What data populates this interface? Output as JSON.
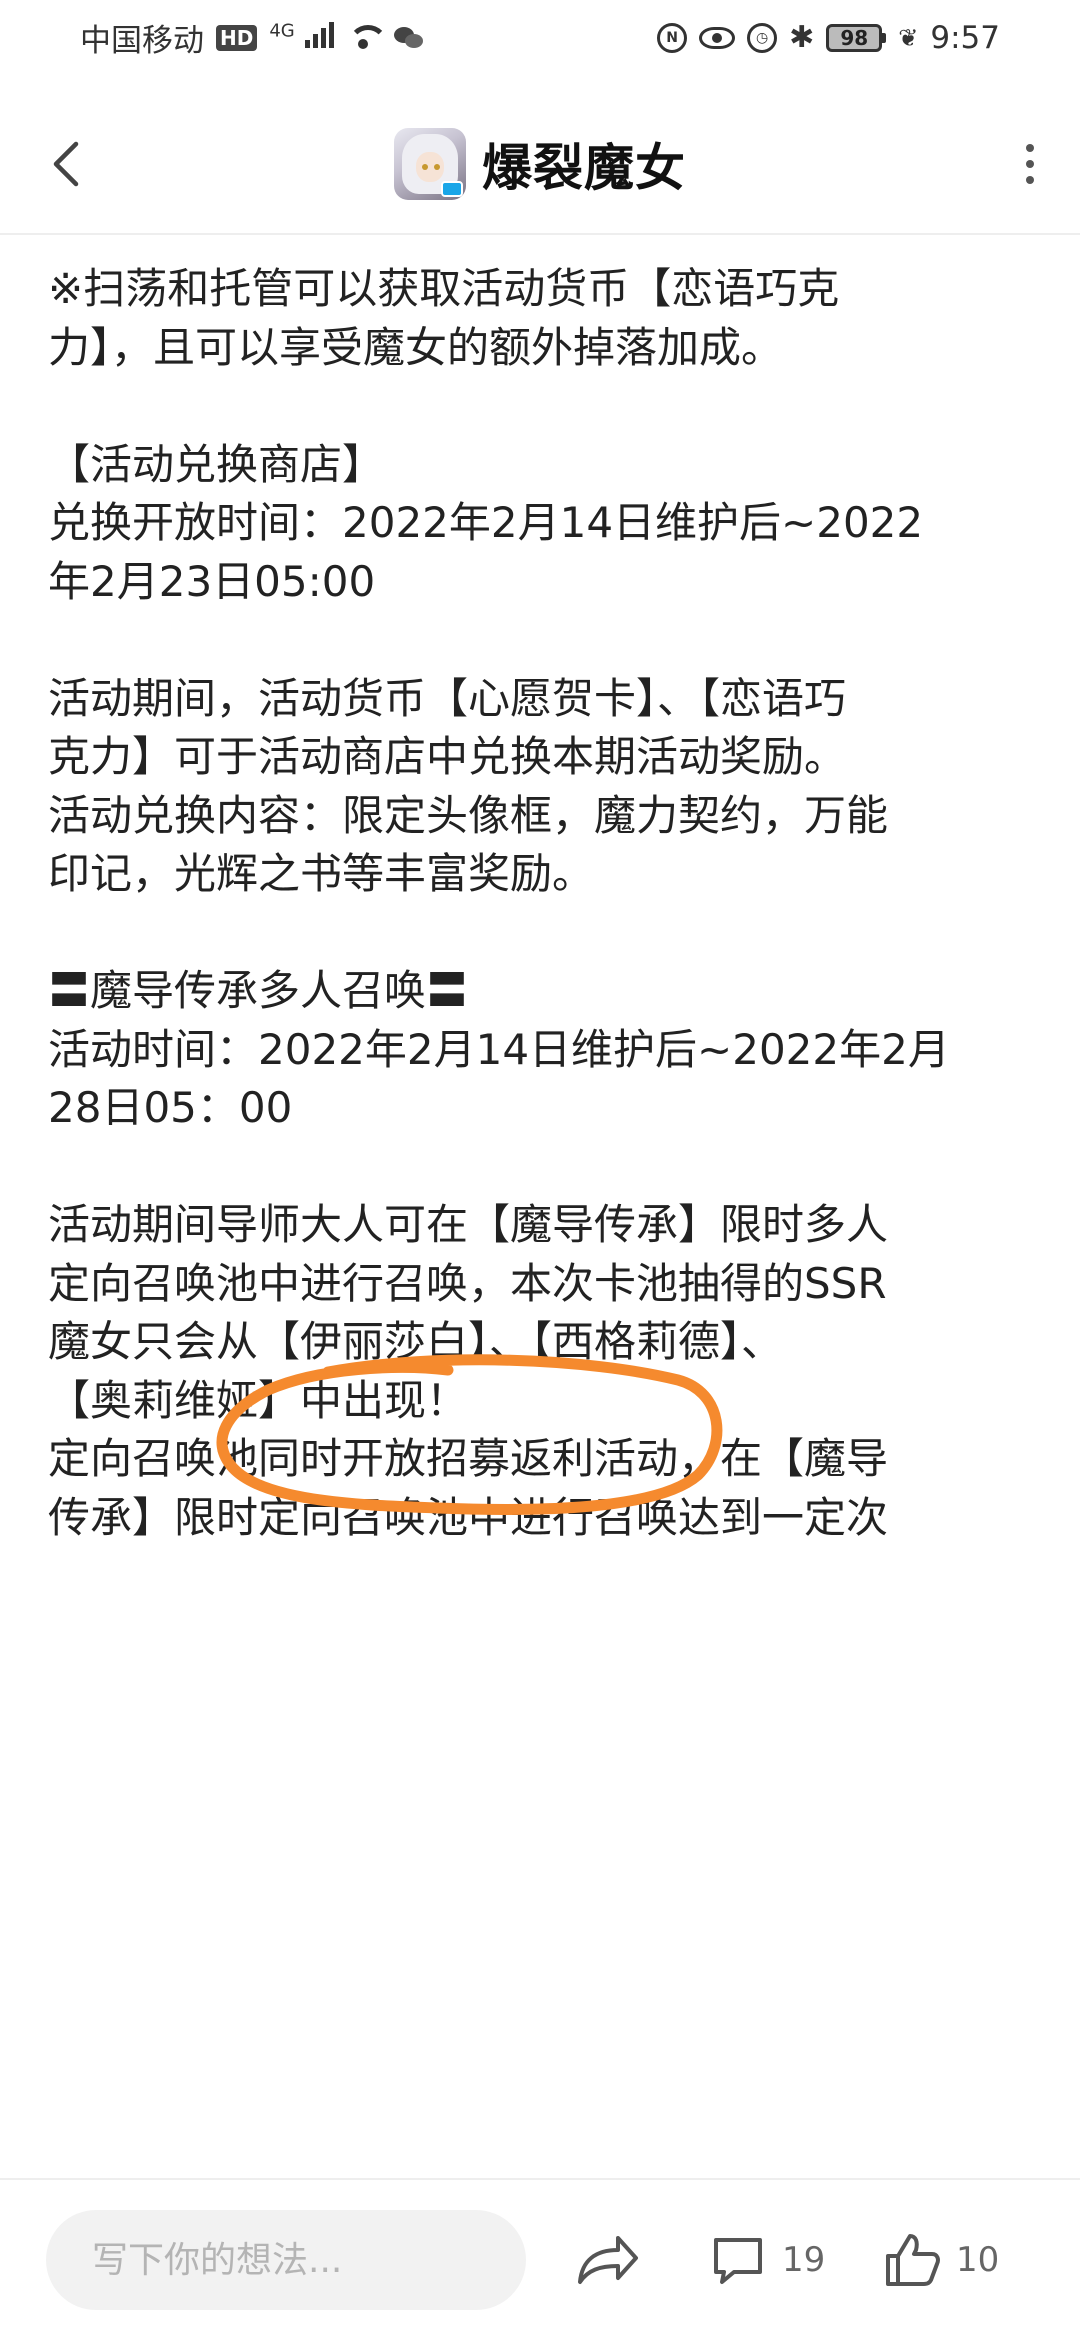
{
  "status_bar": {
    "carrier": "中国移动",
    "hd": "HD",
    "network": "4G",
    "battery": "98",
    "time": "9:57"
  },
  "header": {
    "title": "爆裂魔女"
  },
  "article": {
    "lines": [
      "※扫荡和托管可以获取活动货币【恋语巧克",
      "力】，且可以享受魔女的额外掉落加成。",
      "",
      "【活动兑换商店】",
      "兑换开放时间：2022年2月14日维护后~2022",
      "年2月23日05:00",
      "",
      "活动期间，活动货币【心愿贺卡】、【恋语巧",
      "克力】可于活动商店中兑换本期活动奖励。",
      "活动兑换内容：限定头像框，魔力契约，万能",
      "印记，光辉之书等丰富奖励。",
      "",
      "〓魔导传承多人召唤〓",
      "活动时间：2022年2月14日维护后~2022年2月",
      "28日05：00",
      "",
      "活动期间导师大人可在【魔导传承】限时多人",
      "定向召唤池中进行召唤，本次卡池抽得的SSR",
      "魔女只会从【伊丽莎白】、【西格莉德】、",
      "【奥莉维娅】中出现！",
      "定向召唤池同时开放招募返利活动，在【魔导",
      "传承】限时定向召唤池中进行召唤达到一定次"
    ]
  },
  "bottom_bar": {
    "comment_placeholder": "写下你的想法...",
    "comment_count": "19",
    "like_count": "10"
  },
  "colors": {
    "annotation": "#F58A2E",
    "text": "#222222",
    "divider": "#EEEEEE"
  }
}
